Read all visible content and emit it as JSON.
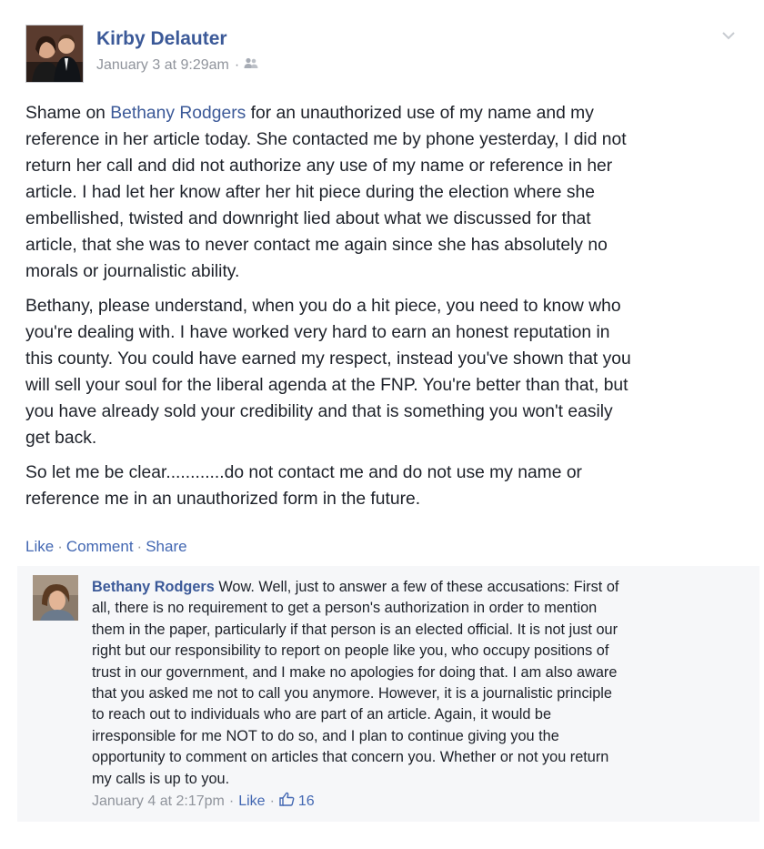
{
  "post": {
    "author": "Kirby Delauter",
    "timestamp": "January 3 at 9:29am",
    "audience_icon": "friends-icon",
    "menu_icon": "chevron-down-icon",
    "paragraph1": {
      "lead": "Shame on ",
      "mention": "Bethany Rodgers",
      "lines": [
        " for an unauthorized use of my name and my",
        "reference in her article today. She contacted me by phone yesterday, I did not",
        "return her call and did not authorize any use of my name or reference in her",
        "article. I had let her know after her hit piece during the election where she",
        "embellished, twisted and downright lied about what we discussed for that",
        "article, that she was to never contact me again since she has absolutely no",
        "morals or journalistic ability."
      ]
    },
    "paragraph2": [
      "Bethany, please understand, when you do a hit piece, you need to know who",
      "you're dealing with. I have worked very hard to earn an honest reputation in",
      "this county. You could have earned my respect, instead you've shown that you",
      "will sell your soul for the liberal agenda at the FNP. You're better than that, but",
      "you have already sold your credibility and that is something you won't easily",
      "get back."
    ],
    "paragraph3": [
      "So let me be clear............do not contact me and do not use my name or",
      "reference me in an unauthorized form in the future."
    ],
    "actions": {
      "like": "Like",
      "comment": "Comment",
      "share": "Share",
      "separator": "·"
    }
  },
  "comment": {
    "author": "Bethany Rodgers",
    "lines": [
      " Wow. Well, just to answer a few of these accusations: First of",
      "all, there is no requirement to get a person's authorization in order to mention",
      "them in the paper, particularly if that person is an elected official. It is not just our",
      "right but our responsibility to report on people like you, who occupy positions of",
      "trust in our government, and I make no apologies for doing that. I am also aware",
      "that you asked me not to call you anymore. However, it is a journalistic principle",
      "to reach out to individuals who are part of an article. Again, it would be",
      "irresponsible for me NOT to do so, and I plan to continue giving you the",
      "opportunity to comment on articles that concern you. Whether or not you return",
      "my calls is up to you."
    ],
    "timestamp": "January 4 at 2:17pm",
    "like": "Like",
    "separator": "·",
    "like_icon": "thumbs-up-icon",
    "like_count": "16"
  }
}
